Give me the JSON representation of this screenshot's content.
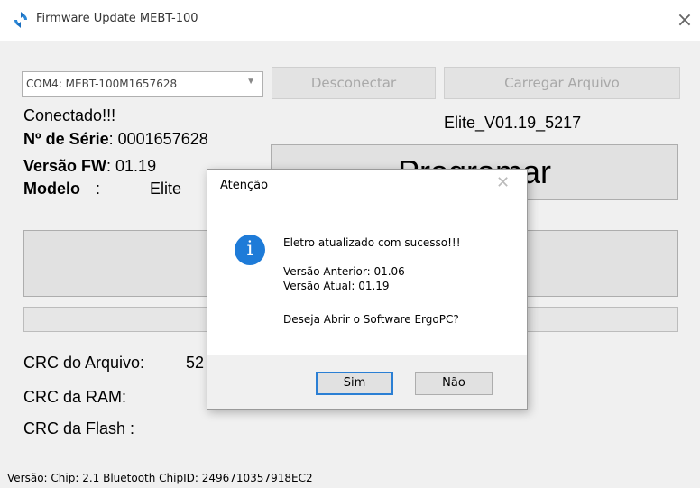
{
  "window": {
    "title": "Firmware Update MEBT-100"
  },
  "port_select": {
    "value": "COM4: MEBT-100M1657628"
  },
  "buttons": {
    "disconnect": "Desconectar",
    "load_file": "Carregar Arquivo",
    "program": "Programar"
  },
  "device": {
    "status": "Conectado!!!",
    "serial_label": "Nº de Série",
    "serial_value": ": 0001657628",
    "fw_label": "Versão FW",
    "fw_value": ": 01.19",
    "model_label": "Modelo",
    "model_value": ":",
    "model_name": "Elite"
  },
  "file_name": "Elite_V01.19_5217",
  "crc": {
    "file_label": "CRC do Arquivo:",
    "file_value": "52",
    "ram_label": "CRC  da RAM:",
    "flash_label": "CRC  da Flash :"
  },
  "status_bar": "Versão:  Chip:  2.1 Bluetooth ChipID: 2496710357918EC2",
  "dialog": {
    "title": "Atenção",
    "message": "Eletro atualizado com sucesso!!!",
    "previous_version": "Versão Anterior: 01.06",
    "current_version": "Versão Atual: 01.19",
    "question": "Deseja Abrir o Software ErgoPC?",
    "yes": "Sim",
    "no": "Não",
    "info_glyph": "i"
  }
}
